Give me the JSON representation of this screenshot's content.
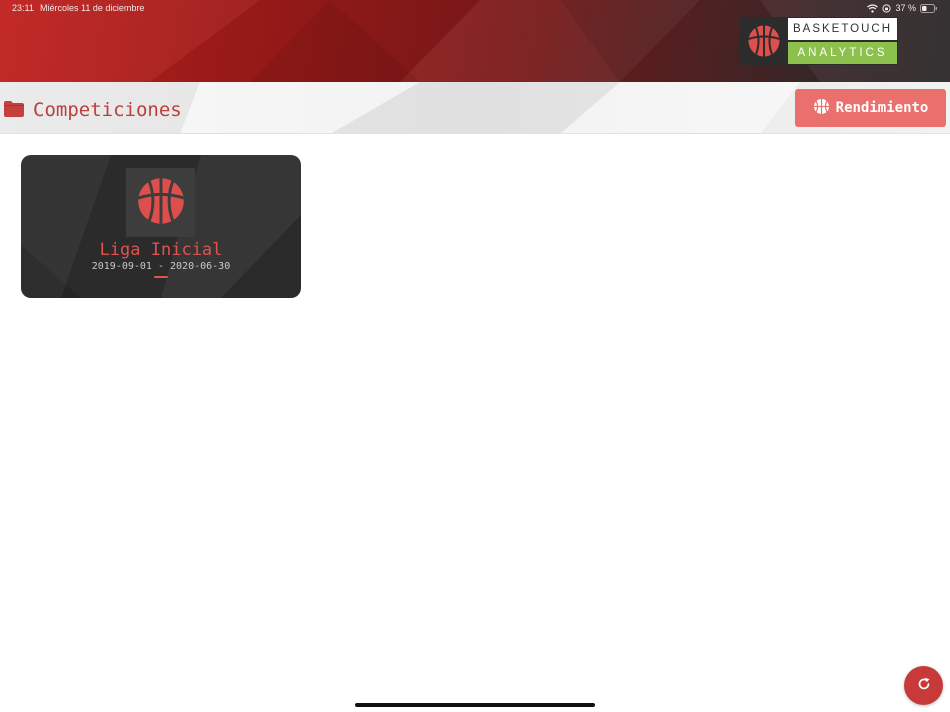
{
  "status_bar": {
    "time": "23:11",
    "date": "Miércoles 11 de diciembre",
    "battery": "37 %"
  },
  "brand": {
    "line1": "BASKETOUCH",
    "line2": "ANALYTICS",
    "icon": "basketball-icon"
  },
  "section": {
    "title": "Competiciones",
    "icon": "folder-icon"
  },
  "performance_button": {
    "label": "Rendimiento",
    "icon": "basketball-icon"
  },
  "competitions": [
    {
      "name": "Liga Inicial",
      "dates": "2019-09-01 - 2020-06-30"
    }
  ],
  "refresh_button": {
    "icon": "refresh-icon"
  },
  "colors": {
    "header_red": "#c1221f",
    "accent_red": "#e0524e",
    "button_salmon": "#e9706d",
    "brand_green": "#8dc14d",
    "card_dark": "#2f2f2f",
    "fab_red": "#c8393a"
  }
}
